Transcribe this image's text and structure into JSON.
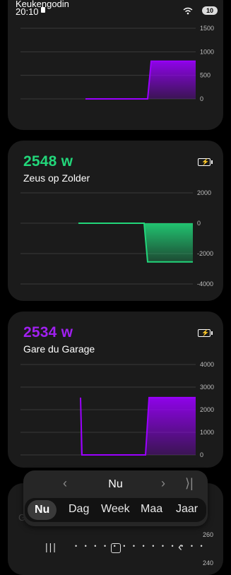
{
  "status": {
    "time": "20:10",
    "battery": "10"
  },
  "cards": [
    {
      "title": "Keukengodin",
      "chart_data": {
        "type": "area",
        "ticks": [
          "1500",
          "1000",
          "500",
          "0"
        ],
        "ylim": [
          0,
          1500
        ],
        "x": [
          0,
          1,
          2,
          3,
          4,
          5
        ],
        "values": [
          0,
          0,
          0,
          0,
          800,
          800
        ],
        "color": "#9b00ff"
      }
    },
    {
      "power": "2548",
      "unit": "w",
      "color": "#22d67a",
      "name": "Zeus op Zolder",
      "chart_data": {
        "type": "area",
        "ticks": [
          "2000",
          "0",
          "-2000",
          "-4000"
        ],
        "ylim": [
          -4000,
          2000
        ],
        "x": [
          0,
          1,
          2,
          3,
          4,
          5
        ],
        "values": [
          0,
          0,
          0,
          0,
          -2548,
          -2548
        ],
        "color": "#22d67a"
      }
    },
    {
      "power": "2534",
      "unit": "w",
      "color": "#a020f0",
      "name": "Gare du Garage",
      "chart_data": {
        "type": "area",
        "ticks": [
          "4000",
          "3000",
          "2000",
          "1000",
          "0"
        ],
        "ylim": [
          0,
          4000
        ],
        "x": [
          0,
          1,
          2,
          3,
          4,
          5
        ],
        "values": [
          2534,
          0,
          0,
          0,
          2534,
          2534
        ],
        "color": "#9b00ff"
      }
    }
  ],
  "peek": {
    "label": "Gebruik",
    "ticks": [
      "260",
      "240"
    ]
  },
  "nav": {
    "prev": "‹",
    "current": "Nu",
    "next": "›",
    "last": "⟩|",
    "tabs": [
      "Nu",
      "Dag",
      "Week",
      "Maa",
      "Jaar"
    ],
    "active": "Nu"
  },
  "gesture": {
    "menu": "|||",
    "back": "‹"
  }
}
